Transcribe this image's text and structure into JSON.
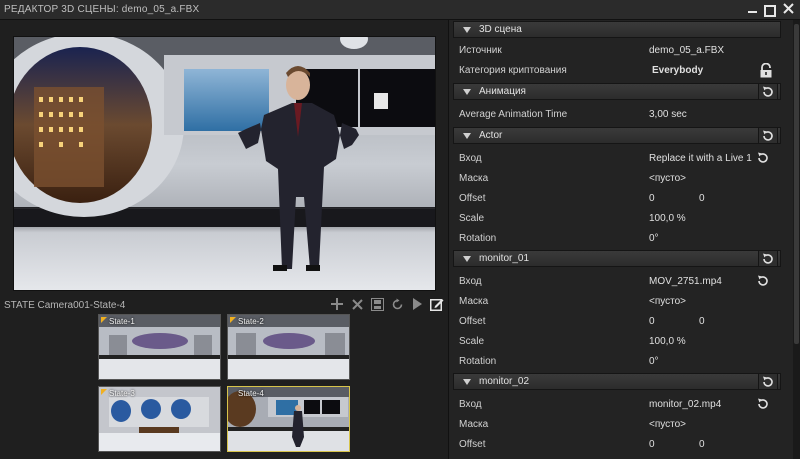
{
  "window": {
    "title": "РЕДАКТОР 3D СЦЕНЫ: demo_05_a.FBX"
  },
  "states": {
    "label": "STATE Camera001-State-4",
    "thumbs": [
      {
        "label": "State-1",
        "selected": false
      },
      {
        "label": "State-2",
        "selected": false
      },
      {
        "label": "State-3",
        "selected": false
      },
      {
        "label": "State-4",
        "selected": true
      }
    ]
  },
  "sections": {
    "scene": {
      "title": "3D сцена",
      "rows": [
        {
          "key": "Источник",
          "value": "demo_05_a.FBX"
        },
        {
          "key": "Категория криптования",
          "value": "Everybody"
        }
      ]
    },
    "animation": {
      "title": "Анимация",
      "rows": [
        {
          "key": "Average Animation Time",
          "value": "3,00 sec"
        }
      ]
    },
    "actor": {
      "title": "Actor",
      "rows": [
        {
          "key": "Вход",
          "value": "Replace it with a Live 1"
        },
        {
          "key": "Маска",
          "value": "<пусто>"
        },
        {
          "key": "Offset",
          "value": "0",
          "value2": "0"
        },
        {
          "key": "Scale",
          "value": "100,0 %"
        },
        {
          "key": "Rotation",
          "value": "0°"
        }
      ]
    },
    "monitor01": {
      "title": "monitor_01",
      "rows": [
        {
          "key": "Вход",
          "value": "MOV_2751.mp4"
        },
        {
          "key": "Маска",
          "value": "<пусто>"
        },
        {
          "key": "Offset",
          "value": "0",
          "value2": "0"
        },
        {
          "key": "Scale",
          "value": "100,0 %"
        },
        {
          "key": "Rotation",
          "value": "0°"
        }
      ]
    },
    "monitor02": {
      "title": "monitor_02",
      "rows": [
        {
          "key": "Вход",
          "value": "monitor_02.mp4"
        },
        {
          "key": "Маска",
          "value": "<пусто>"
        },
        {
          "key": "Offset",
          "value": "0",
          "value2": "0"
        }
      ]
    }
  },
  "icons": {
    "reset": "reset-icon",
    "lock": "lock-icon",
    "add": "plus-icon",
    "delete": "close-icon",
    "save": "save-icon",
    "refresh": "refresh-icon",
    "play": "play-icon",
    "edit": "edit-icon"
  },
  "colors": {
    "accent_selected": "#d7c44a",
    "state_flag": "#f0b020"
  }
}
